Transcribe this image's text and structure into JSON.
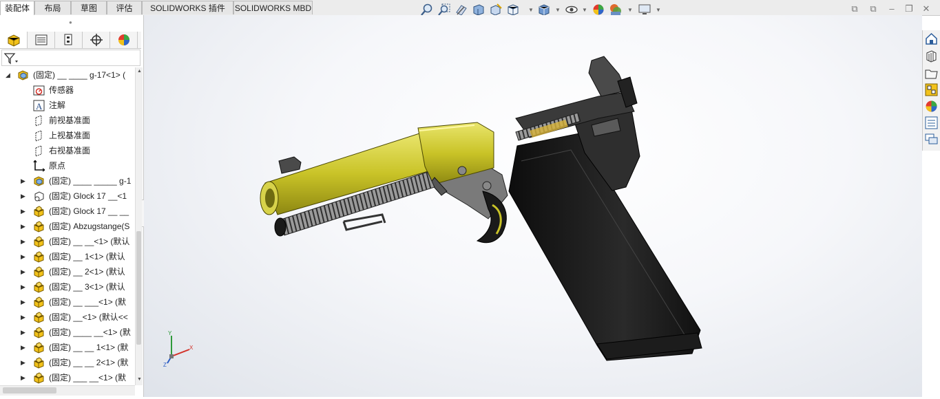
{
  "tabs": [
    {
      "label": "装配体",
      "active": true
    },
    {
      "label": "布局",
      "active": false
    },
    {
      "label": "草图",
      "active": false
    },
    {
      "label": "评估",
      "active": false
    },
    {
      "label": "SOLIDWORKS 插件",
      "active": false
    },
    {
      "label": "SOLIDWORKS MBD",
      "active": false
    }
  ],
  "tree": {
    "root": "(固定) __ ____ g-17<1> (",
    "items": [
      {
        "label": "传感器",
        "icon": "sensor-icon"
      },
      {
        "label": "注解",
        "icon": "annotation-icon"
      },
      {
        "label": "前视基准面",
        "icon": "plane-icon"
      },
      {
        "label": "上视基准面",
        "icon": "plane-icon"
      },
      {
        "label": "右视基准面",
        "icon": "plane-icon"
      },
      {
        "label": "原点",
        "icon": "origin-icon"
      }
    ],
    "components": [
      {
        "label": "(固定) ____ _____ g-1",
        "icon": "subassembly-icon"
      },
      {
        "label": "(固定) Glock 17 __<1",
        "icon": "assembly-rigid-icon"
      },
      {
        "label": "(固定) Glock 17 __ __",
        "icon": "part-icon"
      },
      {
        "label": "(固定) Abzugstange(S",
        "icon": "part-icon"
      },
      {
        "label": "(固定) __ __<1> (默认",
        "icon": "part-icon"
      },
      {
        "label": "(固定) __ 1<1> (默认",
        "icon": "part-icon"
      },
      {
        "label": "(固定) __ 2<1> (默认",
        "icon": "part-icon"
      },
      {
        "label": "(固定) __ 3<1> (默认",
        "icon": "part-icon"
      },
      {
        "label": "(固定) __ ___<1> (默",
        "icon": "part-icon"
      },
      {
        "label": "(固定) __<1> (默认<<",
        "icon": "part-icon"
      },
      {
        "label": "(固定) ____ __<1> (默",
        "icon": "part-icon"
      },
      {
        "label": "(固定) __ __ 1<1> (默",
        "icon": "part-icon"
      },
      {
        "label": "(固定) __ __ 2<1> (默",
        "icon": "part-icon"
      },
      {
        "label": "(固定) ___ __<1> (默",
        "icon": "part-icon"
      }
    ]
  },
  "triad": {
    "x": "X",
    "y": "Y",
    "z": "Z"
  },
  "colors": {
    "barrel": "#c9c327",
    "dark": "#1a1a1a",
    "accent": "#2a6bc4"
  }
}
